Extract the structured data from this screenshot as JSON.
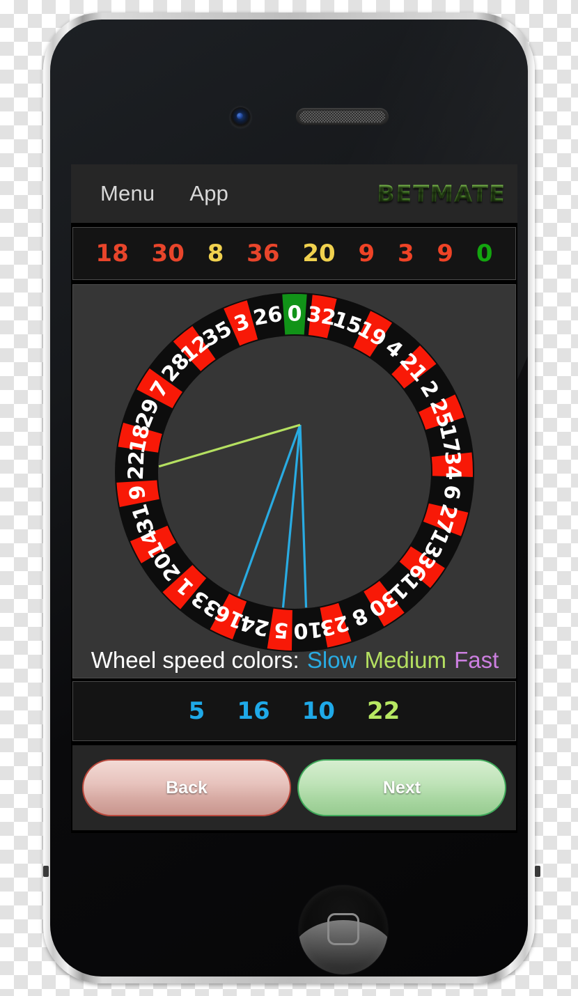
{
  "header": {
    "menu_label": "Menu",
    "app_label": "App",
    "brand": "BETMATE"
  },
  "history": {
    "numbers": [
      {
        "value": "18",
        "color": "#e8452b"
      },
      {
        "value": "30",
        "color": "#e8452b"
      },
      {
        "value": "8",
        "color": "#f0d14e"
      },
      {
        "value": "36",
        "color": "#e8452b"
      },
      {
        "value": "20",
        "color": "#f0d14e"
      },
      {
        "value": "9",
        "color": "#ef4326"
      },
      {
        "value": "3",
        "color": "#ef4326"
      },
      {
        "value": "9",
        "color": "#ef4326"
      },
      {
        "value": "0",
        "color": "#13a50f"
      }
    ]
  },
  "wheel": {
    "pockets": [
      {
        "number": "0",
        "color": "green"
      },
      {
        "number": "32",
        "color": "red"
      },
      {
        "number": "15",
        "color": "black"
      },
      {
        "number": "19",
        "color": "red"
      },
      {
        "number": "4",
        "color": "black"
      },
      {
        "number": "21",
        "color": "red"
      },
      {
        "number": "2",
        "color": "black"
      },
      {
        "number": "25",
        "color": "red"
      },
      {
        "number": "17",
        "color": "black"
      },
      {
        "number": "34",
        "color": "red"
      },
      {
        "number": "6",
        "color": "black"
      },
      {
        "number": "27",
        "color": "red"
      },
      {
        "number": "13",
        "color": "black"
      },
      {
        "number": "36",
        "color": "red"
      },
      {
        "number": "11",
        "color": "black"
      },
      {
        "number": "30",
        "color": "red"
      },
      {
        "number": "8",
        "color": "black"
      },
      {
        "number": "23",
        "color": "red"
      },
      {
        "number": "10",
        "color": "black"
      },
      {
        "number": "5",
        "color": "red"
      },
      {
        "number": "24",
        "color": "black"
      },
      {
        "number": "16",
        "color": "red"
      },
      {
        "number": "33",
        "color": "black"
      },
      {
        "number": "1",
        "color": "red"
      },
      {
        "number": "20",
        "color": "black"
      },
      {
        "number": "14",
        "color": "red"
      },
      {
        "number": "31",
        "color": "black"
      },
      {
        "number": "9",
        "color": "red"
      },
      {
        "number": "22",
        "color": "black"
      },
      {
        "number": "18",
        "color": "red"
      },
      {
        "number": "29",
        "color": "black"
      },
      {
        "number": "7",
        "color": "red"
      },
      {
        "number": "28",
        "color": "black"
      },
      {
        "number": "12",
        "color": "red"
      },
      {
        "number": "35",
        "color": "black"
      },
      {
        "number": "3",
        "color": "red"
      },
      {
        "number": "26",
        "color": "black"
      }
    ],
    "pointers": [
      {
        "target": "16",
        "speed": "Slow",
        "color": "#29abe2"
      },
      {
        "target": "5",
        "speed": "Slow",
        "color": "#29abe2"
      },
      {
        "target": "10",
        "speed": "Slow",
        "color": "#29abe2"
      },
      {
        "target": "22",
        "speed": "Medium",
        "color": "#b5e061"
      }
    ],
    "colors": {
      "red": "#f81907",
      "black": "#0d0d0d",
      "green": "#119318",
      "text": "#ffffff",
      "face": "#363636"
    }
  },
  "legend": {
    "label": "Wheel speed colors:",
    "items": [
      {
        "label": "Slow",
        "color": "#29abe2"
      },
      {
        "label": "Medium",
        "color": "#b5e061"
      },
      {
        "label": "Fast",
        "color": "#cc7fe0"
      }
    ]
  },
  "predictions": {
    "numbers": [
      {
        "value": "5",
        "color": "#1fa9e8"
      },
      {
        "value": "16",
        "color": "#1fa9e8"
      },
      {
        "value": "10",
        "color": "#1fa9e8"
      },
      {
        "value": "22",
        "color": "#b7e862"
      }
    ]
  },
  "footer": {
    "back_label": "Back",
    "next_label": "Next"
  }
}
